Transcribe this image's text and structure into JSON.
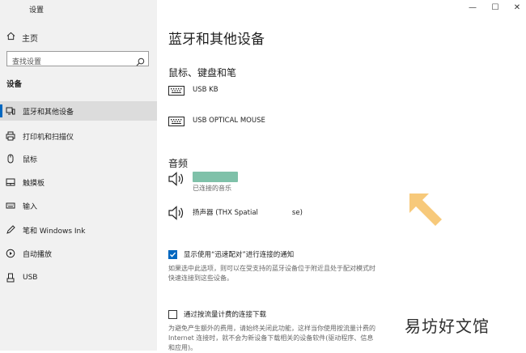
{
  "window": {
    "title": "设置",
    "controls": [
      "—",
      "☐",
      "✕"
    ]
  },
  "sidebar": {
    "home_label": "主页",
    "search_placeholder": "查找设置",
    "section_label": "设备",
    "items": [
      {
        "label": "蓝牙和其他设备",
        "icon": "bluetooth-devices-icon",
        "active": true
      },
      {
        "label": "打印机和扫描仪",
        "icon": "printer-icon",
        "active": false
      },
      {
        "label": "鼠标",
        "icon": "mouse-icon",
        "active": false
      },
      {
        "label": "触摸板",
        "icon": "touchpad-icon",
        "active": false
      },
      {
        "label": "输入",
        "icon": "keyboard-icon",
        "active": false
      },
      {
        "label": "笔和 Windows Ink",
        "icon": "pen-icon",
        "active": false
      },
      {
        "label": "自动播放",
        "icon": "autoplay-icon",
        "active": false
      },
      {
        "label": "USB",
        "icon": "usb-icon",
        "active": false
      }
    ]
  },
  "main": {
    "title": "蓝牙和其他设备",
    "input_section": {
      "heading": "鼠标、键盘和笔",
      "devices": [
        {
          "name": "USB KB",
          "icon": "keyboard-icon"
        },
        {
          "name": "USB OPTICAL MOUSE",
          "icon": "keyboard-icon"
        }
      ]
    },
    "audio_section": {
      "heading": "音频",
      "devices": [
        {
          "name": "",
          "status": "已连接的音乐",
          "icon": "speaker-icon"
        },
        {
          "name": "扬声器 (THX Spatial",
          "name_tail": "se)",
          "icon": "speaker-icon"
        }
      ]
    },
    "swift_pair": {
      "checked": true,
      "label": "显示使用“迅速配对”进行连接的通知",
      "desc_line1": "如果选中此选项，则可以在受支持的蓝牙设备位于附近且处于配对模式时",
      "desc_line2": "快速连接到这些设备。"
    },
    "metered": {
      "checked": false,
      "label": "通过按流量计费的连接下载",
      "desc_line1": "为避免产生额外的费用，请始终关闭此功能，这样当你使用按流量计费的",
      "desc_line2": "Internet 连接时，就不会为新设备下载相关的设备软件(驱动程序、信息",
      "desc_line3": "和应用)。"
    }
  },
  "watermark": "易坊好文馆",
  "colors": {
    "accent": "#0067c0",
    "sidebar_bg": "#f1f1f1",
    "arrow": "#f7c97a",
    "redacted": "#7fc1a9"
  }
}
